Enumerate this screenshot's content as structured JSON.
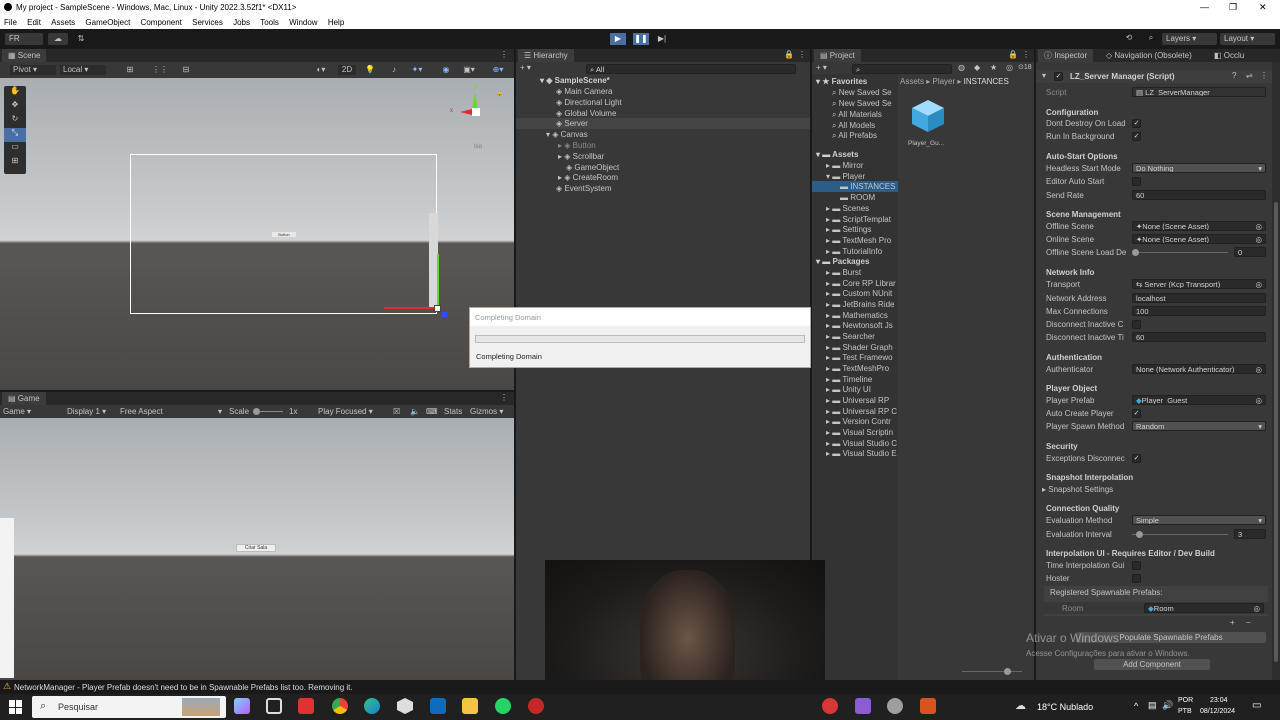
{
  "title_bar": {
    "title": "My project - SampleScene - Windows, Mac, Linux - Unity 2022.3.52f1* <DX11>",
    "controls": [
      "—",
      "❐",
      "✕"
    ]
  },
  "menu": [
    "File",
    "Edit",
    "Assets",
    "GameObject",
    "Component",
    "Services",
    "Jobs",
    "Tools",
    "Window",
    "Help"
  ],
  "toolbar": {
    "account": "FR",
    "layers": "Layers",
    "layout": "Layout"
  },
  "scene": {
    "tab": "Scene",
    "pivot": "Pivot",
    "local": "Local",
    "mode_2d": "2D",
    "gizmo_label": "Iso",
    "ui_text": "Button"
  },
  "game": {
    "tab": "Game",
    "mode": "Game",
    "display": "Display 1",
    "aspect": "Free Aspect",
    "scale_label": "Scale",
    "scale_value": "1x",
    "play": "Play Focused",
    "stats": "Stats",
    "gizmos": "Gizmos",
    "button_text": "Criar Sala"
  },
  "hierarchy": {
    "tab": "Hierarchy",
    "search": "All",
    "scene": "SampleScene*",
    "items": [
      "Main Camera",
      "Directional Light",
      "Global Volume",
      "Server",
      "Canvas",
      "Button",
      "Scrollbar",
      "GameObject",
      "CreateRoom",
      "EventSystem"
    ]
  },
  "project": {
    "tab": "Project",
    "count": "18",
    "breadcrumb": [
      "Assets",
      "Player",
      "INSTANCES"
    ],
    "favorites_title": "Favorites",
    "favorites": [
      "New Saved Se",
      "New Saved Se",
      "All Materials",
      "All Models",
      "All Prefabs"
    ],
    "assets_title": "Assets",
    "assets": [
      "Mirror",
      "Player",
      "INSTANCES",
      "ROOM",
      "Scenes",
      "ScriptTemplat",
      "Settings",
      "TextMesh Pro",
      "TutorialInfo"
    ],
    "packages_title": "Packages",
    "packages": [
      "Burst",
      "Core RP Librar",
      "Custom NUnit",
      "JetBrains Ride",
      "Mathematics",
      "Newtonsoft Js",
      "Searcher",
      "Shader Graph",
      "Test Framewo",
      "TextMeshPro",
      "Timeline",
      "Unity UI",
      "Universal RP",
      "Universal RP C",
      "Version Contr",
      "Visual Scriptin",
      "Visual Studio C",
      "Visual Studio E"
    ],
    "asset_item": "Player_Gu..."
  },
  "dialog": {
    "title": "Completing Domain",
    "progress": 0.0,
    "message": "Completing Domain"
  },
  "inspector": {
    "tab": "Inspector",
    "tab2": "Navigation (Obsolete)",
    "tab3": "Occlu",
    "component": "LZ_Server Manager (Script)",
    "script_label": "Script",
    "script_value": "LZ_ServerManager",
    "sections": {
      "configuration": "Configuration",
      "autostart": "Auto-Start Options",
      "scene_mgmt": "Scene Management",
      "network": "Network Info",
      "auth": "Authentication",
      "player": "Player Object",
      "security": "Security",
      "snapshot": "Snapshot Interpolation",
      "conn": "Connection Quality",
      "interp_ui": "Interpolation UI - Requires Editor / Dev Build"
    },
    "fields": {
      "dont_destroy": "Dont Destroy On Load",
      "run_bg": "Run In Background",
      "headless": "Headless Start Mode",
      "headless_v": "Do Nothing",
      "editor_auto": "Editor Auto Start",
      "send_rate": "Send Rate",
      "send_rate_v": "60",
      "offline": "Offline Scene",
      "offline_v": "None (Scene Asset)",
      "online": "Online Scene",
      "online_v": "None (Scene Asset)",
      "offline_delay": "Offline Scene Load De",
      "offline_delay_v": "0",
      "transport": "Transport",
      "transport_v": "Server (Kcp Transport)",
      "address": "Network Address",
      "address_v": "localhost",
      "max_conn": "Max Connections",
      "max_conn_v": "100",
      "disc_c": "Disconnect Inactive C",
      "disc_t": "Disconnect Inactive Ti",
      "disc_t_v": "60",
      "authenticator": "Authenticator",
      "authenticator_v": "None (Network Authenticator)",
      "player_prefab": "Player Prefab",
      "player_prefab_v": "Player_Guest",
      "auto_create": "Auto Create Player",
      "spawn_method": "Player Spawn Method",
      "spawn_method_v": "Random",
      "exceptions": "Exceptions Disconnec",
      "snapshot_settings": "Snapshot Settings",
      "eval_method": "Evaluation Method",
      "eval_method_v": "Simple",
      "eval_interval": "Evaluation Interval",
      "eval_interval_v": "3",
      "time_interp": "Time Interpolation Gui",
      "hoster": "Hoster",
      "registered": "Registered Spawnable Prefabs:",
      "room_label": "Room",
      "room_value": "Room",
      "populate": "Populate Spawnable Prefabs",
      "add_component": "Add Component"
    }
  },
  "watermark": {
    "line1": "Ativar o Windows",
    "line2": "Acesse Configurações para ativar o Windows."
  },
  "status": {
    "message": "NetworkManager - Player Prefab doesn't need to be in Spawnable Prefabs list too. Removing it."
  },
  "taskbar": {
    "search": "Pesquisar",
    "weather": "18°C Nublado",
    "lang1": "POR",
    "lang2": "PTB",
    "time": "23:04",
    "date": "08/12/2024"
  }
}
